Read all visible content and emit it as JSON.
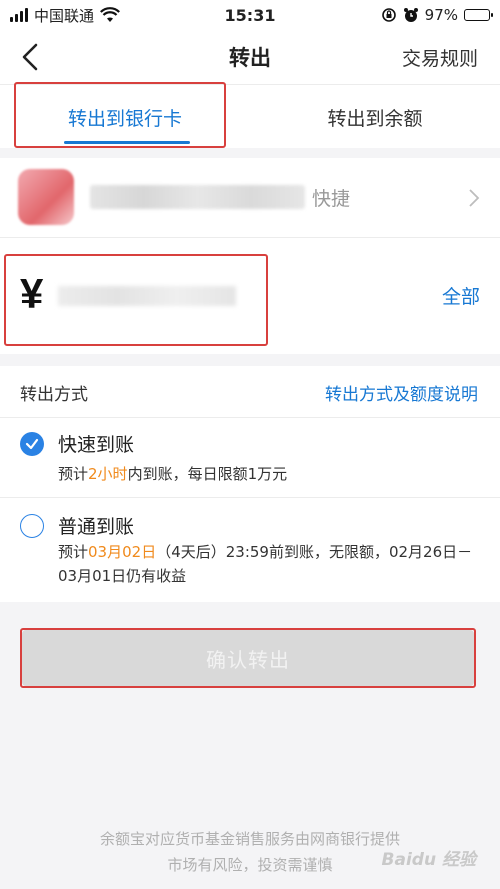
{
  "status_bar": {
    "carrier": "中国联通",
    "time": "15:31",
    "battery": "97%",
    "battery_level": 0.97
  },
  "nav": {
    "title": "转出",
    "right_link": "交易规则"
  },
  "tabs": [
    {
      "label": "转出到银行卡",
      "active": true
    },
    {
      "label": "转出到余额",
      "active": false
    }
  ],
  "card": {
    "label": "快捷"
  },
  "amount": {
    "currency_symbol": "¥",
    "all_label": "全部"
  },
  "transfer_method": {
    "label": "转出方式",
    "info_link": "转出方式及额度说明",
    "options": [
      {
        "title": "快速到账",
        "selected": true,
        "desc_prefix": "预计",
        "desc_highlight": "2小时",
        "desc_suffix": "内到账，每日限额1万元"
      },
      {
        "title": "普通到账",
        "selected": false,
        "desc_prefix": "预计",
        "desc_highlight": "03月02日",
        "desc_suffix": "（4天后）23:59前到账，无限额，02月26日－03月01日仍有收益"
      }
    ]
  },
  "confirm_button": "确认转出",
  "footer": {
    "line1": "余额宝对应货币基金销售服务由网商银行提供",
    "line2": "市场有风险，投资需谨慎"
  },
  "watermark": "Baidu 经验",
  "colors": {
    "accent": "#1778d3",
    "highlight": "#f08a1c",
    "annotation_box": "#d8403e",
    "disabled_button": "#d9d9d9"
  }
}
